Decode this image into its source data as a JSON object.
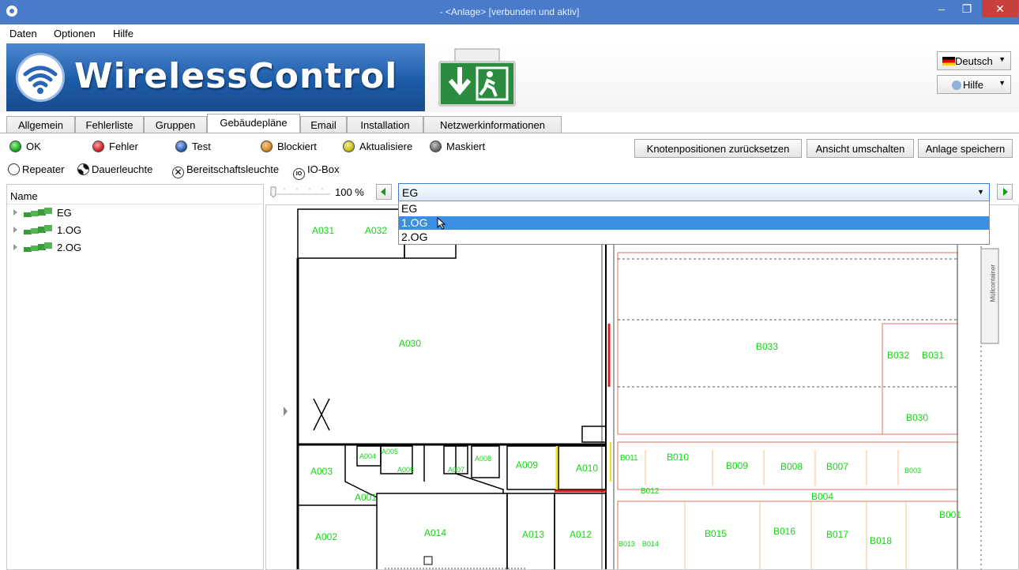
{
  "window": {
    "title": "- <Anlage> [verbunden und aktiv]",
    "minimize": "–",
    "maximize": "❐",
    "close": "✕"
  },
  "menu": [
    "Daten",
    "Optionen",
    "Hilfe"
  ],
  "banner": {
    "brand": "WirelessControl",
    "language_button": "Deutsch",
    "help_button": "Hilfe"
  },
  "tabs": [
    {
      "label": "Allgemein"
    },
    {
      "label": "Fehlerliste"
    },
    {
      "label": "Gruppen"
    },
    {
      "label": "Gebäudepläne",
      "active": true
    },
    {
      "label": "Email"
    },
    {
      "label": "Installation"
    },
    {
      "label": "Netzwerkinformationen"
    }
  ],
  "status_legend": [
    {
      "label": "OK",
      "color": "#1fb01f"
    },
    {
      "label": "Fehler",
      "color": "#d8262b"
    },
    {
      "label": "Test",
      "color": "#2f5fb8"
    },
    {
      "label": "Blockiert",
      "color": "#d98a21"
    },
    {
      "label": "Aktualisiere",
      "color": "#c8c21a"
    },
    {
      "label": "Maskiert",
      "color": "#6b6b6b"
    }
  ],
  "toolbar": {
    "reset_positions": "Knotenpositionen zurücksetzen",
    "toggle_view": "Ansicht umschalten",
    "save_plant": "Anlage speichern"
  },
  "symbols": [
    "Repeater",
    "Dauerleuchte",
    "Bereitschaftsleuchte",
    "IO-Box"
  ],
  "tree": {
    "header": "Name",
    "items": [
      {
        "label": "EG"
      },
      {
        "label": "1.OG"
      },
      {
        "label": "2.OG"
      }
    ]
  },
  "map": {
    "zoom": "100 %",
    "floor_selected": "EG",
    "floor_options": [
      "EG",
      "1.OG",
      "2.OG"
    ],
    "highlighted_option": "1.OG",
    "rooms": [
      "A031",
      "A032",
      "A030",
      "A003",
      "A004",
      "A005",
      "A006",
      "A007",
      "A008",
      "A009",
      "A010",
      "A001",
      "A002",
      "A014",
      "A013",
      "A012",
      "B033",
      "B032",
      "B031",
      "B030",
      "B010",
      "B011",
      "B009",
      "B008",
      "B007",
      "B003",
      "B004",
      "B012",
      "B001",
      "B015",
      "B016",
      "B017",
      "B018",
      "B013",
      "B014"
    ],
    "side_label": "Müllcontainer"
  }
}
